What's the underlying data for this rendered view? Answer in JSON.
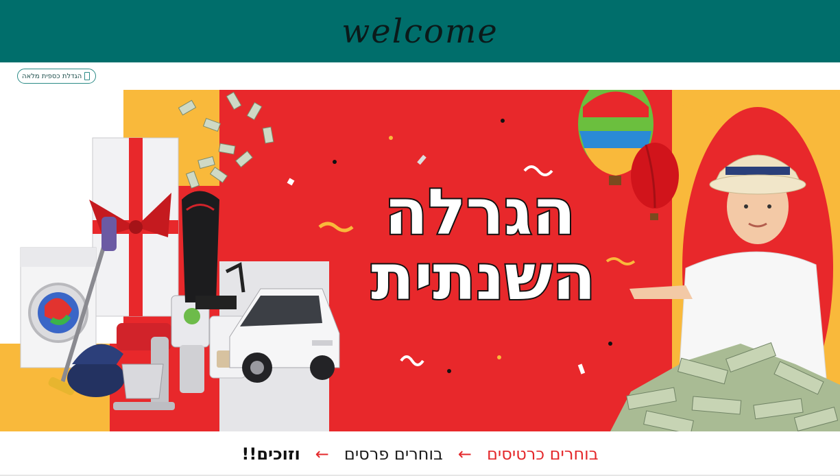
{
  "header": {
    "title": "welcome",
    "background": "#006e6b"
  },
  "toolbar": {
    "fullscreen_label": "הגדלת כספית מלאה",
    "fullscreen_icon": "phone-icon"
  },
  "banner": {
    "headline_line1": "הגרלה",
    "headline_line2": "השנתית",
    "colors": {
      "red": "#e8282b",
      "yellow": "#f9b93b",
      "white": "#ffffff"
    }
  },
  "steps": {
    "step1": "בוחרים כרטיסים",
    "step2": "בוחרים פרסים",
    "step3": "וזוכים!!",
    "arrow": "←"
  }
}
